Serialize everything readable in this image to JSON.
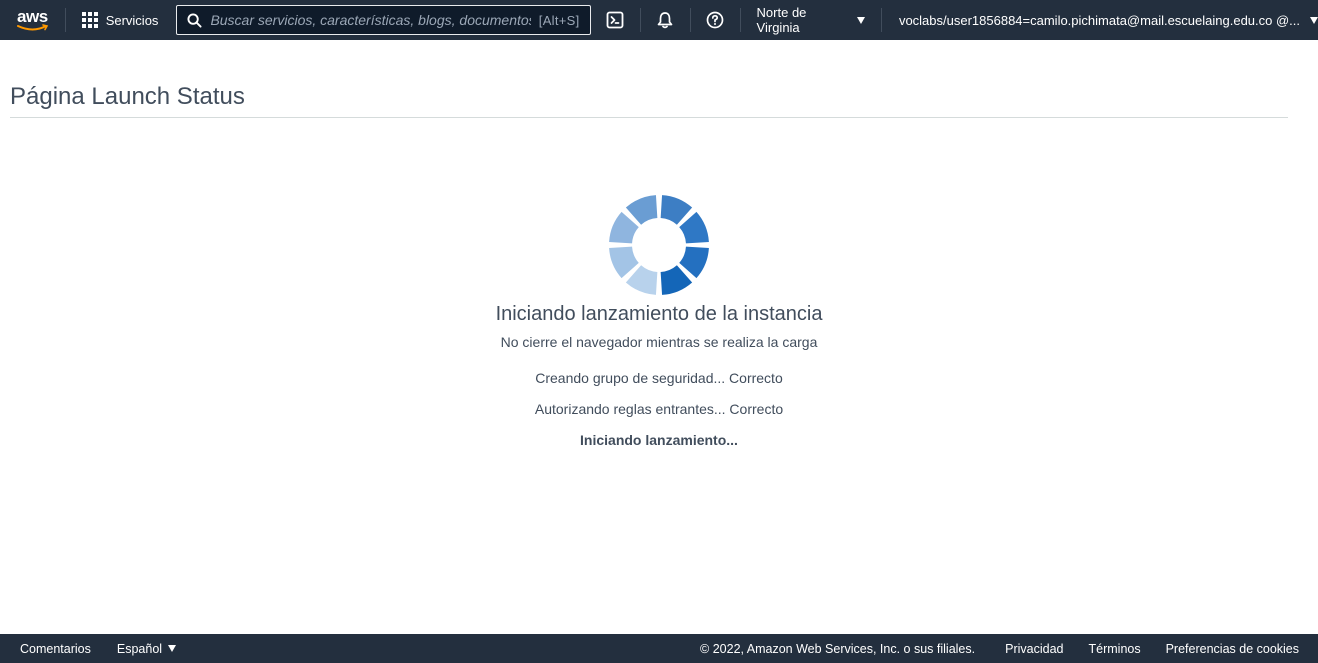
{
  "topnav": {
    "logo_text": "aws",
    "services_label": "Servicios",
    "search_placeholder": "Buscar servicios, características, blogs, documentos",
    "search_shortcut": "[Alt+S]",
    "region_label": "Norte de Virginia",
    "account_label": "voclabs/user1856884=camilo.pichimata@mail.escuelaing.edu.co @...",
    "icons": [
      "grid-icon",
      "search-icon",
      "cloudshell-icon",
      "bell-icon",
      "help-icon",
      "caret-down-icon"
    ]
  },
  "page": {
    "title": "Página Launch Status"
  },
  "status": {
    "heading": "Iniciando lanzamiento de la instancia",
    "subheading": "No cierre el navegador mientras se realiza la carga",
    "steps": [
      "Creando grupo de seguridad... Correcto",
      "Autorizando reglas entrantes... Correcto",
      "Iniciando lanzamiento..."
    ]
  },
  "footer": {
    "feedback": "Comentarios",
    "language": "Español",
    "copyright": "© 2022, Amazon Web Services, Inc. o sus filiales.",
    "links": [
      "Privacidad",
      "Términos",
      "Preferencias de cookies"
    ]
  },
  "colors": {
    "nav_bg": "#232f3e",
    "spinner_dark": "#1466b8",
    "spinner_light": "#b8d2ec"
  }
}
